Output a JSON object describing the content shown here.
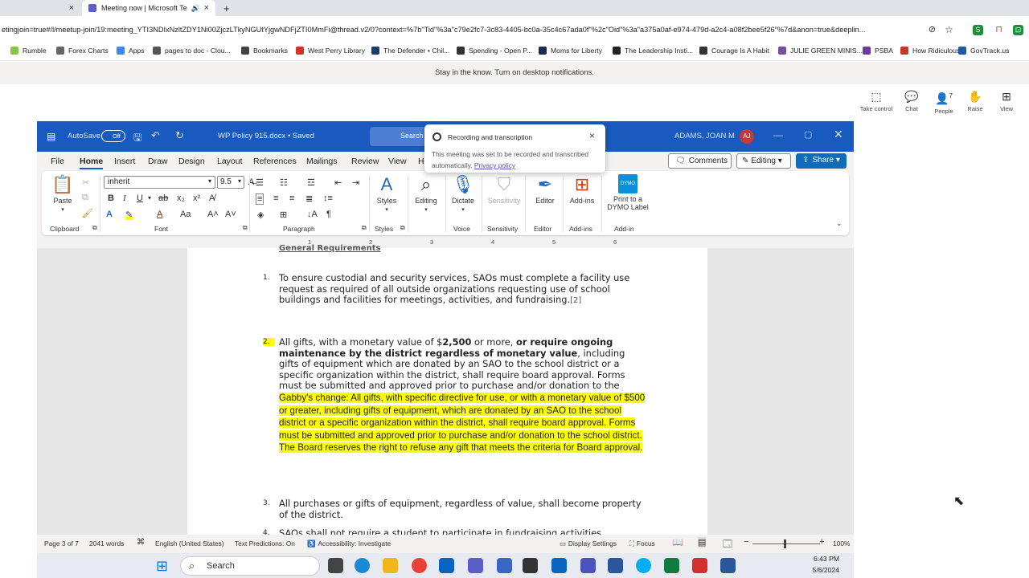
{
  "browser": {
    "tab_prev_close": "×",
    "tab_active_title": "Meeting now | Microsoft Te",
    "tab_close": "×",
    "new_tab": "+",
    "url": "etingjoin=true#/l/meetup-join/19:meeting_YTI3NDIxNzltZDY1Ni00ZjczLTkyNGUtYjgwNDFjZTI0MmFi@thread.v2/0?context=%7b\"Tid\"%3a\"c79e2fc7-3c83-4405-bc0a-35c4c67ada0f\"%2c\"Oid\"%3a\"a375a0af-e974-479d-a2c4-a08f2bee5f26\"%7d&anon=true&deeplin..."
  },
  "bookmarks": [
    {
      "label": "Rumble",
      "color": "#85c742"
    },
    {
      "label": "Forex Charts",
      "color": "#666666"
    },
    {
      "label": "Apps",
      "color": "#4285f4"
    },
    {
      "label": "pages to doc - Clou...",
      "color": "#555555"
    },
    {
      "label": "Bookmarks",
      "color": "#444444"
    },
    {
      "label": "West Perry Library",
      "color": "#d93025"
    },
    {
      "label": "The Defender • Chil...",
      "color": "#1a3d6d"
    },
    {
      "label": "Spending - Open P...",
      "color": "#333333"
    },
    {
      "label": "Moms for Liberty",
      "color": "#1b2a52"
    },
    {
      "label": "The Leadership Insti...",
      "color": "#222222"
    },
    {
      "label": "Courage Is A Habit",
      "color": "#333333"
    },
    {
      "label": "JULIE GREEN MINIS...",
      "color": "#7b4fa0"
    },
    {
      "label": "PSBA",
      "color": "#6a3d9a"
    },
    {
      "label": "How Ridiculous",
      "color": "#c0392b"
    },
    {
      "label": "GovTrack.us",
      "color": "#1e5aa8"
    }
  ],
  "teams": {
    "notice": "Stay in the know. Turn on desktop notifications.",
    "take_control": "Take control",
    "chat": "Chat",
    "people": "People",
    "people_count": "7",
    "raise": "Raise",
    "view": "View"
  },
  "popup": {
    "title": "Recording and transcription",
    "body": "This meeting was set to be recorded and transcribed automatically.",
    "link": "Privacy policy",
    "close": "×"
  },
  "word": {
    "autosave": "AutoSave",
    "autosave_state": "Off",
    "doc_title": "WP Policy 915.docx • Saved",
    "search": "Search",
    "user": "ADAMS, JOAN M",
    "user_initials": "AJ",
    "menu": [
      "File",
      "Home",
      "Insert",
      "Draw",
      "Design",
      "Layout",
      "References",
      "Mailings",
      "Review",
      "View",
      "H"
    ],
    "comments": "Comments",
    "editing": "Editing",
    "share": "Share",
    "font": "inherit",
    "font_size": "9.5",
    "groups": {
      "clipboard": "Clipboard",
      "font": "Font",
      "paragraph": "Paragraph",
      "styles": "Styles",
      "voice": "Voice",
      "sensitivity": "Sensitivity",
      "editor": "Editor",
      "addins": "Add-ins",
      "addin": "Add-in"
    },
    "paste": "Paste",
    "styles": "Styles",
    "editing_btn": "Editing",
    "dictate": "Dictate",
    "sensitivity": "Sensitivity",
    "editor": "Editor",
    "addins": "Add-ins",
    "dymo_line1": "Print to a",
    "dymo_line2": "DYMO Label",
    "ruler_ticks": [
      "1",
      "2",
      "3",
      "4",
      "5",
      "6"
    ],
    "doc": {
      "heading_partial": "General Requirements",
      "p1_num": "1.",
      "p1": "To ensure custodial and security services, SAOs must complete a facility use request as required of all outside organizations requesting use of school buildings and facilities for meetings, activities, and fundraising.",
      "p1_ref": "[2]",
      "p2_num": "2.",
      "p2_a": "All gifts, with a monetary value of $",
      "p2_b": "2,500",
      "p2_c": " or more, ",
      "p2_d": "or require ongoing maintenance by the district regardless of monetary value",
      "p2_e": ", including gifts of equipment which are donated by an SAO to the school district or a specific organization within the district, shall require board approval. Forms must be submitted and approved prior to purchase and/or donation to the school district.",
      "p2_change": "Gabby's change: All gifts, with specific directive for use, or with a monetary value of $500 or greater, including gifts of equipment, which are donated by an SAO to the school district or a specific organization within the district, shall require board approval.  Forms must be submitted and approved prior to purchase and/or donation to the school district.  The Board reserves the right to refuse any gift that meets the criteria for Board approval.",
      "p3_num": "3.",
      "p3": "All purchases or gifts of equipment, regardless of value, shall become property of the district.",
      "p4_num": "4.",
      "p4_partial": "SAOs shall not require a student to participate in fundraising activities"
    },
    "status": {
      "page": "Page 3 of 7",
      "words": "2041 words",
      "language": "English (United States)",
      "predictions": "Text Predictions: On",
      "accessibility": "Accessibility: Investigate",
      "display": "Display Settings",
      "focus": "Focus",
      "zoom": "100%"
    }
  },
  "taskbar": {
    "search": "Search",
    "time": "6:43 PM",
    "date": "5/6/2024"
  }
}
